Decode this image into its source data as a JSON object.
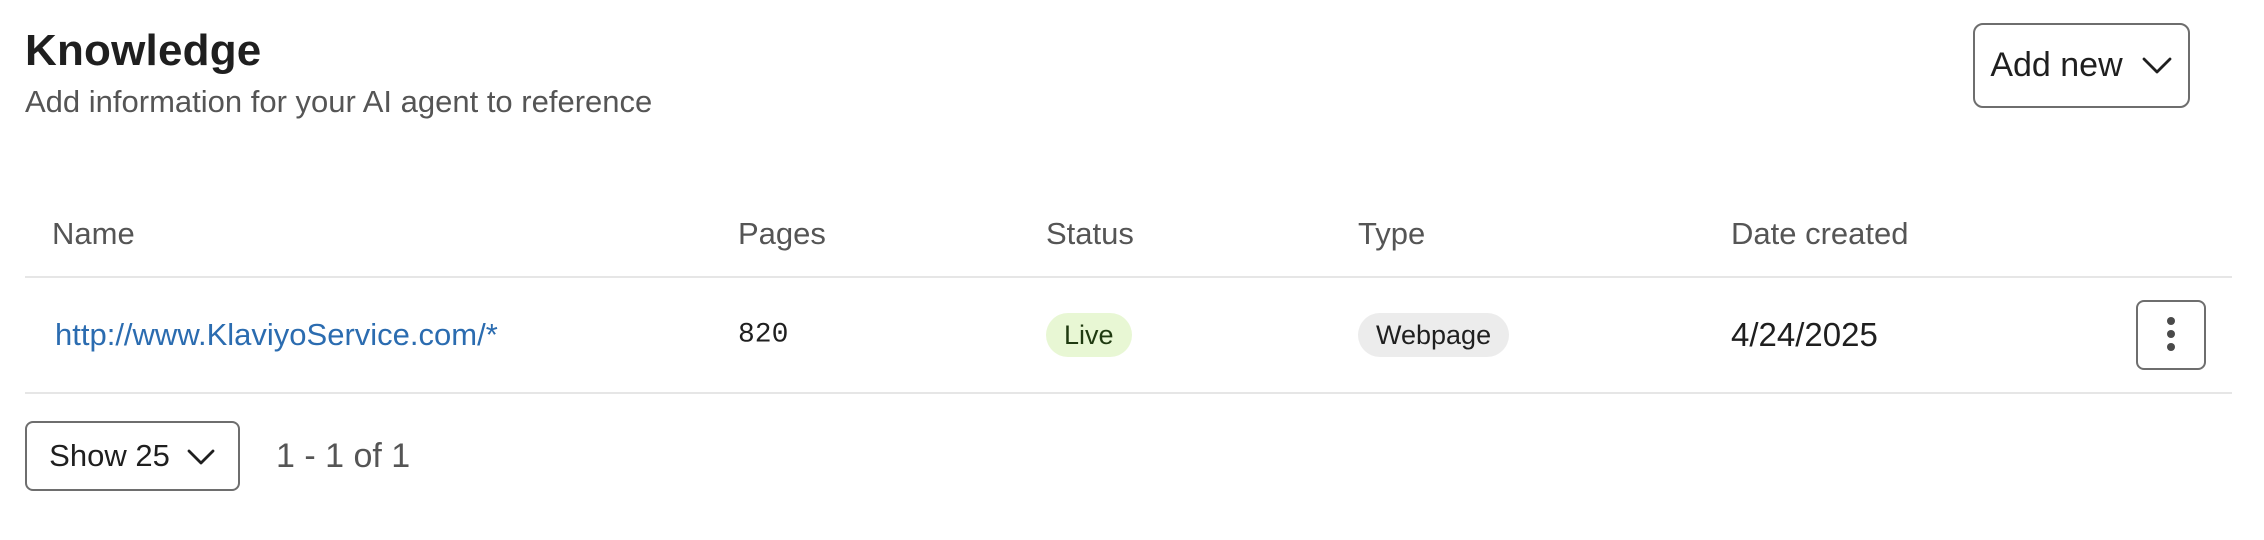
{
  "header": {
    "title": "Knowledge",
    "subtitle": "Add information for your AI agent to reference",
    "add_new_label": "Add new"
  },
  "table": {
    "columns": {
      "name": "Name",
      "pages": "Pages",
      "status": "Status",
      "type": "Type",
      "date_created": "Date created"
    },
    "rows": [
      {
        "name": "http://www.KlaviyoService.com/*",
        "pages": "820",
        "status": "Live",
        "type": "Webpage",
        "date_created": "4/24/2025"
      }
    ]
  },
  "footer": {
    "page_size_label": "Show 25",
    "pagination": "1 - 1 of 1"
  },
  "colors": {
    "link": "#2b6cb0",
    "status_live_bg": "#e8f7d4",
    "type_badge_bg": "#ececec"
  },
  "icons": {
    "add_new_chevron": "chevron-down-icon",
    "row_menu": "kebab-menu-icon",
    "page_size_chevron": "chevron-down-icon"
  }
}
